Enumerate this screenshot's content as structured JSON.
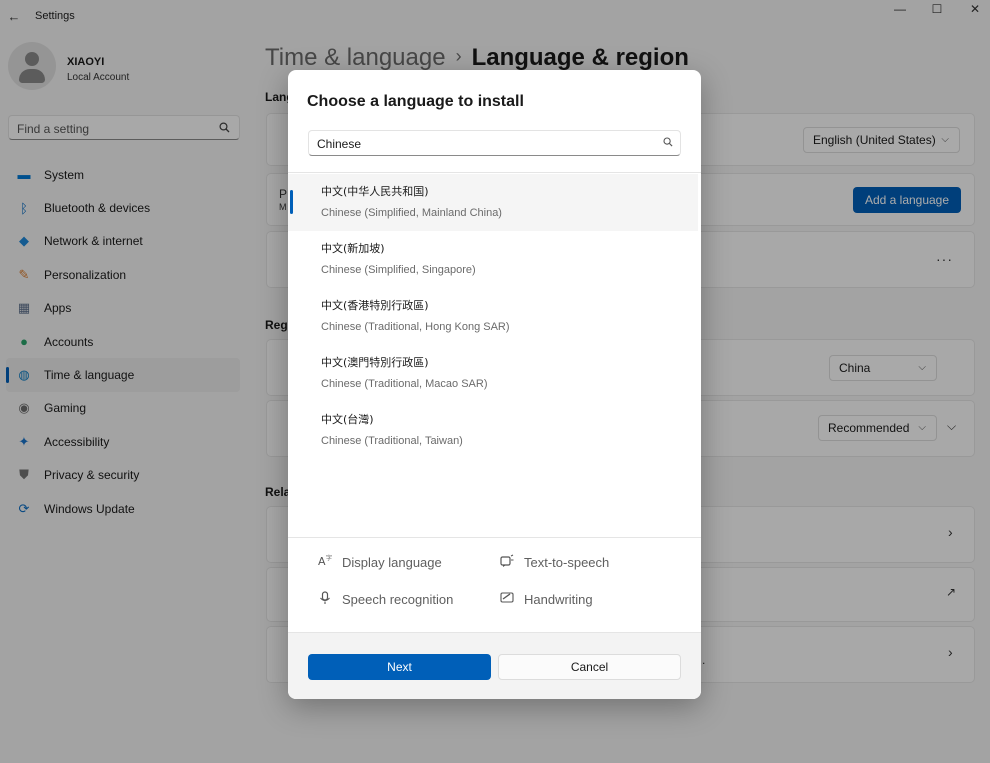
{
  "window": {
    "title": "Settings",
    "back_glyph": "←",
    "minimize_glyph": "—",
    "maximize_glyph": "☐",
    "close_glyph": "✕"
  },
  "profile": {
    "name": "XIAOYI",
    "account_type": "Local Account"
  },
  "search": {
    "placeholder": "Find a setting"
  },
  "sidebar": {
    "items": [
      {
        "label": "System",
        "icon": "monitor-icon",
        "color": "#0078d4"
      },
      {
        "label": "Bluetooth & devices",
        "icon": "bluetooth-icon",
        "color": "#0067c0"
      },
      {
        "label": "Network & internet",
        "icon": "wifi-icon",
        "color": "#1f88d8"
      },
      {
        "label": "Personalization",
        "icon": "brush-icon",
        "color": "#d97a2b"
      },
      {
        "label": "Apps",
        "icon": "apps-icon",
        "color": "#5a6d8a"
      },
      {
        "label": "Accounts",
        "icon": "person-icon",
        "color": "#2aa36b"
      },
      {
        "label": "Time & language",
        "icon": "globe-clock-icon",
        "color": "#0a7bc2",
        "active": true
      },
      {
        "label": "Gaming",
        "icon": "controller-icon",
        "color": "#6e6e6e"
      },
      {
        "label": "Accessibility",
        "icon": "accessibility-icon",
        "color": "#1a73c9"
      },
      {
        "label": "Privacy & security",
        "icon": "shield-icon",
        "color": "#737373"
      },
      {
        "label": "Windows Update",
        "icon": "update-icon",
        "color": "#0a6cc2"
      }
    ]
  },
  "breadcrumb": {
    "parent": "Time & language",
    "separator": "›",
    "current": "Language & region"
  },
  "background": {
    "section_language": "Lang",
    "section_region": "Regi",
    "section_related": "Rela",
    "display_language_value": "English (United States)",
    "add_language_label": "Add a language",
    "country_value": "China",
    "format_value": "Recommended",
    "more_glyph": "···",
    "chevron_glyph": "›",
    "row_frag_p": "P",
    "row_frag_m": "M",
    "fragment_period": "."
  },
  "dialog": {
    "title": "Choose a language to install",
    "search_value": "Chinese",
    "languages": [
      {
        "native": "中文(中华人民共和国)",
        "english": "Chinese (Simplified, Mainland China)",
        "selected": true
      },
      {
        "native": "中文(新加坡)",
        "english": "Chinese (Simplified, Singapore)"
      },
      {
        "native": "中文(香港特別行政區)",
        "english": "Chinese (Traditional, Hong Kong SAR)"
      },
      {
        "native": "中文(澳門特別行政區)",
        "english": "Chinese (Traditional, Macao SAR)"
      },
      {
        "native": "中文(台灣)",
        "english": "Chinese (Traditional, Taiwan)"
      }
    ],
    "features": {
      "display_language": "Display language",
      "text_to_speech": "Text-to-speech",
      "speech_recognition": "Speech recognition",
      "handwriting": "Handwriting"
    },
    "next_label": "Next",
    "cancel_label": "Cancel"
  }
}
